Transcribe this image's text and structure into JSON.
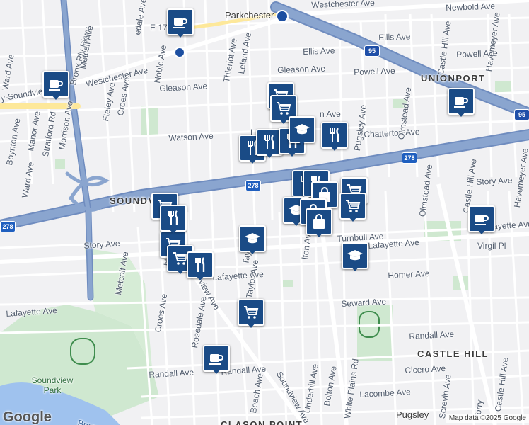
{
  "map": {
    "attribution": "Map data ©2025 Google",
    "logo": "Google",
    "colors": {
      "land": "#f1f1f3",
      "park": "#cfe8d0",
      "water": "#9fc2ee",
      "highway": "#8aa5cf",
      "highway_edge": "#6f8cbf",
      "road": "#ffffff",
      "pin": "#1a4b86"
    },
    "areas": {
      "parkchester": "Parkchester",
      "unionport": "UNIONPORT",
      "castle_hill": "CASTLE HILL",
      "soundview": "SOUNDVIEW",
      "soundview_park": "Soundview Park",
      "pugsley": "Pugsley",
      "clason_point": "CLASON POINT"
    },
    "streets": {
      "westchester_ave_ne": "Westchester Ave",
      "westchester_ave_w": "Westchester Ave",
      "newbold_ave": "Newbold Ave",
      "ellis_ave": "Ellis Ave",
      "ellis_ave2": "Ellis Ave",
      "powell_ave": "Powell Ave",
      "powell_ave2": "Powell Ave",
      "gleason_ave": "Gleason Ave",
      "gleason_ave2": "Gleason Ave",
      "watson_ave": "Watson Ave",
      "chatterton_ave": "Chatterton Ave",
      "story_ave": "Story Ave",
      "story_ave_e": "Story Ave",
      "lafayette_ave": "Lafayette Ave",
      "lafayette_ave_w": "Lafayette Ave",
      "lafayette_ave_e": "Lafayette Ave",
      "lafayette_ave_m": "Lafayette Ave",
      "turnbull_ave": "Turnbull Ave",
      "virgil_pl": "Virgil Pl",
      "homer_ave": "Homer Ave",
      "seward_ave": "Seward Ave",
      "randall_ave": "Randall Ave",
      "randall_ave_w": "Randall Ave",
      "randall_ave_m": "Randall Ave",
      "cicero_ave": "Cicero Ave",
      "lacombe_ave": "Lacombe Ave",
      "e172": "E 172",
      "bronx_riv_pkwy": "Bronx Riv Pkwy",
      "metcalf_ave": "Metcalf Ave",
      "metcalf_ave2": "Metcalf Ave",
      "noble_ave": "Noble Ave",
      "rosedale_ave_n": "edale Ave",
      "rosedale_ave": "Rosedale Ave",
      "thieriot_ave": "Thieriot Ave",
      "leland_ave": "Leland Ave",
      "fteley_ave": "Fteley Ave",
      "croes_ave": "Croes Ave",
      "croes_ave2": "Croes Ave",
      "ward_ave": "Ward Ave",
      "ward_ave2": "Ward Ave",
      "manor_ave": "Manor Ave",
      "stratford_rd": "Stratford Rd",
      "morrison_ave": "Morrison Ave",
      "boynton_ave": "Boynton Ave",
      "soundview_fragment": "y-Soundview",
      "soundview_ave": "Soundview Ave",
      "soundview_ave_n": "view Ave",
      "taylor_ave": "Taylo",
      "taylor_ave2": "Taylor Ave",
      "beach_ave": "Beach Ave",
      "underhill_ave": "Underhill Ave",
      "bolton_ave": "Bolton Ave",
      "white_plains_rd": "White Plains Rd",
      "olmstead_ave": "Olmstead Ave",
      "olmstead_ave2": "Olmstead Ave",
      "castle_hill_ave": "Castle Hill Ave",
      "castle_hill_ave2": "Castle Hill Ave",
      "havemeyer_ave": "Havemeyer Ave",
      "havemeyer_ave2": "Havemeyer Ave",
      "pugsley_ave": "Pugsley Ave",
      "screvin_ave": "Screvin Ave",
      "torry_ave": "Torry",
      "bronx_river": "Bronx",
      "calton_ave": "lton Ave",
      "n_ave": "n Ave",
      "l_frag": "L",
      "ble_ave": "ble Ave"
    },
    "highways": {
      "i278": "278",
      "i95": "95",
      "i95_e": "95"
    },
    "pins": [
      {
        "type": "cafe",
        "name": "cafe-icon"
      },
      {
        "type": "cafe",
        "name": "cafe-icon"
      },
      {
        "type": "cafe",
        "name": "cafe-icon"
      },
      {
        "type": "cafe",
        "name": "cafe-icon"
      },
      {
        "type": "cafe",
        "name": "cafe-icon"
      },
      {
        "type": "grocery",
        "name": "shopping-cart-icon"
      },
      {
        "type": "grocery",
        "name": "shopping-cart-icon"
      },
      {
        "type": "grocery",
        "name": "shopping-cart-icon"
      },
      {
        "type": "grocery",
        "name": "shopping-cart-icon"
      },
      {
        "type": "grocery",
        "name": "shopping-cart-icon"
      },
      {
        "type": "grocery",
        "name": "shopping-cart-icon"
      },
      {
        "type": "grocery",
        "name": "shopping-cart-icon"
      },
      {
        "type": "grocery",
        "name": "shopping-cart-icon"
      },
      {
        "type": "restaurant",
        "name": "fork-knife-icon"
      },
      {
        "type": "restaurant",
        "name": "fork-knife-icon"
      },
      {
        "type": "restaurant",
        "name": "fork-knife-icon"
      },
      {
        "type": "restaurant",
        "name": "fork-knife-icon"
      },
      {
        "type": "restaurant",
        "name": "fork-knife-icon"
      },
      {
        "type": "restaurant",
        "name": "fork-knife-icon"
      },
      {
        "type": "restaurant",
        "name": "fork-knife-icon"
      },
      {
        "type": "restaurant",
        "name": "fork-knife-icon"
      },
      {
        "type": "school",
        "name": "graduation-cap-icon"
      },
      {
        "type": "school",
        "name": "graduation-cap-icon"
      },
      {
        "type": "school",
        "name": "graduation-cap-icon"
      },
      {
        "type": "school",
        "name": "graduation-cap-icon"
      },
      {
        "type": "shopping",
        "name": "shopping-bag-icon"
      },
      {
        "type": "shopping",
        "name": "shopping-bag-icon"
      },
      {
        "type": "shopping",
        "name": "shopping-bag-icon"
      },
      {
        "type": "transit",
        "name": "subway-icon"
      },
      {
        "type": "transit",
        "name": "subway-icon"
      }
    ]
  }
}
